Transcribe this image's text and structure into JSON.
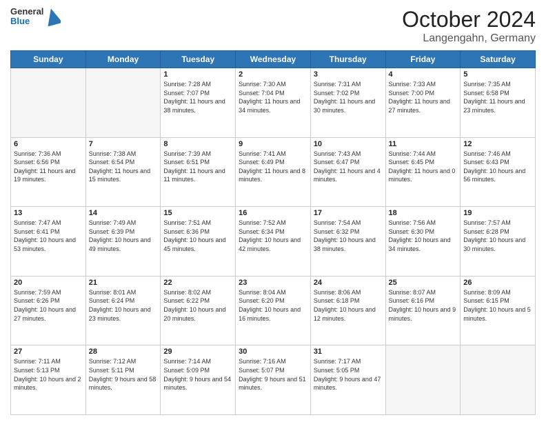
{
  "header": {
    "logo_general": "General",
    "logo_blue": "Blue",
    "title": "October 2024",
    "subtitle": "Langengahn, Germany"
  },
  "days_of_week": [
    "Sunday",
    "Monday",
    "Tuesday",
    "Wednesday",
    "Thursday",
    "Friday",
    "Saturday"
  ],
  "weeks": [
    [
      {
        "day": "",
        "info": ""
      },
      {
        "day": "",
        "info": ""
      },
      {
        "day": "1",
        "info": "Sunrise: 7:28 AM\nSunset: 7:07 PM\nDaylight: 11 hours and 38 minutes."
      },
      {
        "day": "2",
        "info": "Sunrise: 7:30 AM\nSunset: 7:04 PM\nDaylight: 11 hours and 34 minutes."
      },
      {
        "day": "3",
        "info": "Sunrise: 7:31 AM\nSunset: 7:02 PM\nDaylight: 11 hours and 30 minutes."
      },
      {
        "day": "4",
        "info": "Sunrise: 7:33 AM\nSunset: 7:00 PM\nDaylight: 11 hours and 27 minutes."
      },
      {
        "day": "5",
        "info": "Sunrise: 7:35 AM\nSunset: 6:58 PM\nDaylight: 11 hours and 23 minutes."
      }
    ],
    [
      {
        "day": "6",
        "info": "Sunrise: 7:36 AM\nSunset: 6:56 PM\nDaylight: 11 hours and 19 minutes."
      },
      {
        "day": "7",
        "info": "Sunrise: 7:38 AM\nSunset: 6:54 PM\nDaylight: 11 hours and 15 minutes."
      },
      {
        "day": "8",
        "info": "Sunrise: 7:39 AM\nSunset: 6:51 PM\nDaylight: 11 hours and 11 minutes."
      },
      {
        "day": "9",
        "info": "Sunrise: 7:41 AM\nSunset: 6:49 PM\nDaylight: 11 hours and 8 minutes."
      },
      {
        "day": "10",
        "info": "Sunrise: 7:43 AM\nSunset: 6:47 PM\nDaylight: 11 hours and 4 minutes."
      },
      {
        "day": "11",
        "info": "Sunrise: 7:44 AM\nSunset: 6:45 PM\nDaylight: 11 hours and 0 minutes."
      },
      {
        "day": "12",
        "info": "Sunrise: 7:46 AM\nSunset: 6:43 PM\nDaylight: 10 hours and 56 minutes."
      }
    ],
    [
      {
        "day": "13",
        "info": "Sunrise: 7:47 AM\nSunset: 6:41 PM\nDaylight: 10 hours and 53 minutes."
      },
      {
        "day": "14",
        "info": "Sunrise: 7:49 AM\nSunset: 6:39 PM\nDaylight: 10 hours and 49 minutes."
      },
      {
        "day": "15",
        "info": "Sunrise: 7:51 AM\nSunset: 6:36 PM\nDaylight: 10 hours and 45 minutes."
      },
      {
        "day": "16",
        "info": "Sunrise: 7:52 AM\nSunset: 6:34 PM\nDaylight: 10 hours and 42 minutes."
      },
      {
        "day": "17",
        "info": "Sunrise: 7:54 AM\nSunset: 6:32 PM\nDaylight: 10 hours and 38 minutes."
      },
      {
        "day": "18",
        "info": "Sunrise: 7:56 AM\nSunset: 6:30 PM\nDaylight: 10 hours and 34 minutes."
      },
      {
        "day": "19",
        "info": "Sunrise: 7:57 AM\nSunset: 6:28 PM\nDaylight: 10 hours and 30 minutes."
      }
    ],
    [
      {
        "day": "20",
        "info": "Sunrise: 7:59 AM\nSunset: 6:26 PM\nDaylight: 10 hours and 27 minutes."
      },
      {
        "day": "21",
        "info": "Sunrise: 8:01 AM\nSunset: 6:24 PM\nDaylight: 10 hours and 23 minutes."
      },
      {
        "day": "22",
        "info": "Sunrise: 8:02 AM\nSunset: 6:22 PM\nDaylight: 10 hours and 20 minutes."
      },
      {
        "day": "23",
        "info": "Sunrise: 8:04 AM\nSunset: 6:20 PM\nDaylight: 10 hours and 16 minutes."
      },
      {
        "day": "24",
        "info": "Sunrise: 8:06 AM\nSunset: 6:18 PM\nDaylight: 10 hours and 12 minutes."
      },
      {
        "day": "25",
        "info": "Sunrise: 8:07 AM\nSunset: 6:16 PM\nDaylight: 10 hours and 9 minutes."
      },
      {
        "day": "26",
        "info": "Sunrise: 8:09 AM\nSunset: 6:15 PM\nDaylight: 10 hours and 5 minutes."
      }
    ],
    [
      {
        "day": "27",
        "info": "Sunrise: 7:11 AM\nSunset: 5:13 PM\nDaylight: 10 hours and 2 minutes."
      },
      {
        "day": "28",
        "info": "Sunrise: 7:12 AM\nSunset: 5:11 PM\nDaylight: 9 hours and 58 minutes."
      },
      {
        "day": "29",
        "info": "Sunrise: 7:14 AM\nSunset: 5:09 PM\nDaylight: 9 hours and 54 minutes."
      },
      {
        "day": "30",
        "info": "Sunrise: 7:16 AM\nSunset: 5:07 PM\nDaylight: 9 hours and 51 minutes."
      },
      {
        "day": "31",
        "info": "Sunrise: 7:17 AM\nSunset: 5:05 PM\nDaylight: 9 hours and 47 minutes."
      },
      {
        "day": "",
        "info": ""
      },
      {
        "day": "",
        "info": ""
      }
    ]
  ]
}
